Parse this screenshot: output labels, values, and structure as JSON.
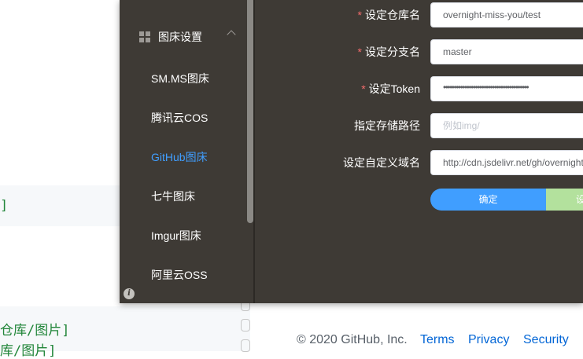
{
  "background_page": {
    "code_line_1": "]",
    "code_line_2": "仓库/图片]",
    "code_line_3": "库/图片]",
    "footer": {
      "copyright": "© 2020 GitHub, Inc.",
      "links": [
        "Terms",
        "Privacy",
        "Security"
      ]
    }
  },
  "sidebar": {
    "group_label": "图床设置",
    "items": [
      {
        "label": "SM.MS图床",
        "active": false
      },
      {
        "label": "腾讯云COS",
        "active": false
      },
      {
        "label": "GitHub图床",
        "active": true
      },
      {
        "label": "七牛图床",
        "active": false
      },
      {
        "label": "Imgur图床",
        "active": false
      },
      {
        "label": "阿里云OSS",
        "active": false
      }
    ]
  },
  "form": {
    "repo": {
      "label": "设定仓库名",
      "value": "overnight-miss-you/test",
      "required": true
    },
    "branch": {
      "label": "设定分支名",
      "value": "master",
      "required": true
    },
    "token": {
      "label": "设定Token",
      "value": "••••••••••••••••••••••••••••••••••••••••",
      "required": true
    },
    "path": {
      "label": "指定存储路径",
      "placeholder": "例如img/",
      "required": false
    },
    "domain": {
      "label": "设定自定义域名",
      "value": "http://cdn.jsdelivr.net/gh/overnight",
      "required": false
    },
    "confirm_label": "确定",
    "secondary_label": "设"
  },
  "colors": {
    "window_bg": "#3e3a35",
    "accent": "#409eff",
    "required": "#f56c6c",
    "secondary_button": "#b3e19d",
    "link": "#0366d6",
    "code_green": "#22863a"
  }
}
